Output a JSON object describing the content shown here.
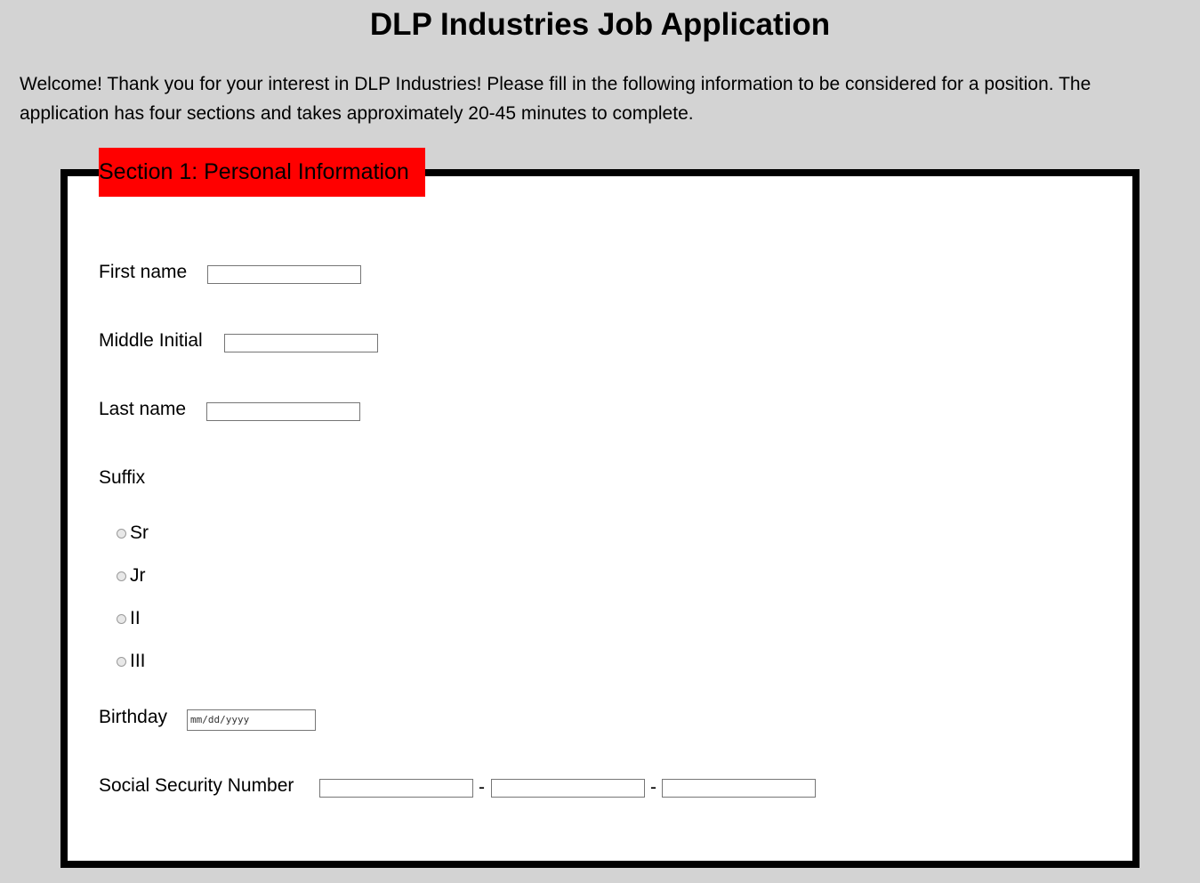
{
  "page": {
    "title": "DLP Industries Job Application",
    "intro": "Welcome! Thank you for your interest in DLP Industries! Please fill in the following information to be considered for a position. The application has four sections and takes approximately 20-45 minutes to complete."
  },
  "section1": {
    "legend": "Section 1: Personal Information",
    "first_name_label": "First name",
    "first_name_value": "",
    "middle_initial_label": "Middle Initial",
    "middle_initial_value": "",
    "last_name_label": "Last name",
    "last_name_value": "",
    "suffix_label": "Suffix",
    "suffix_options": [
      "Sr",
      "Jr",
      "II",
      "III"
    ],
    "birthday_label": "Birthday",
    "birthday_placeholder": "mm/dd/yyyy",
    "ssn_label": "Social Security Number",
    "ssn_separator": "-",
    "ssn_values": [
      "",
      "",
      ""
    ]
  },
  "colors": {
    "page_background": "#d3d3d3",
    "legend_background": "#ff0000",
    "section_background": "#ffffff",
    "section_border": "#000000"
  }
}
